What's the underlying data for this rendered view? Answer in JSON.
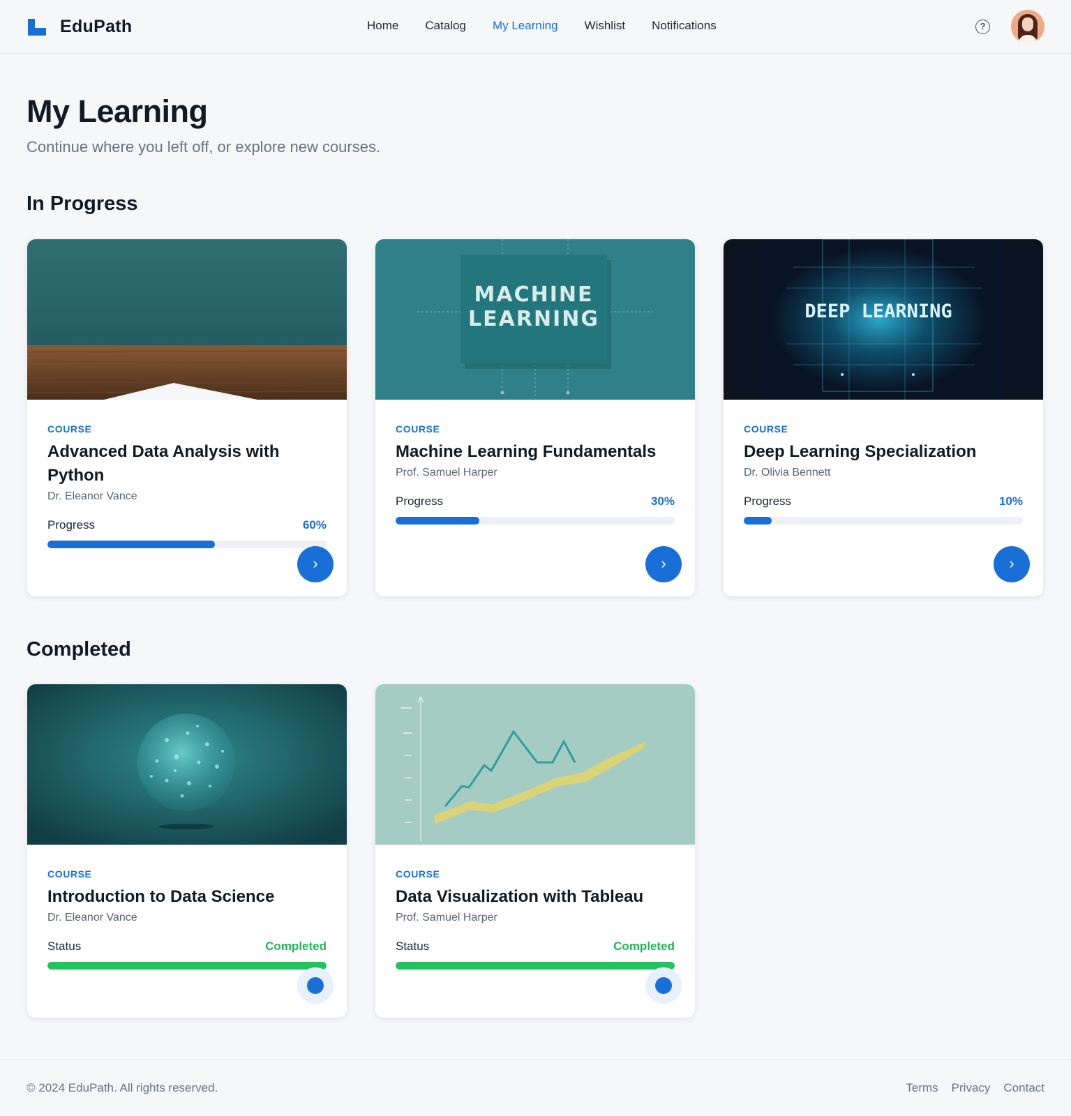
{
  "app": {
    "brand_name": "EduPath",
    "accent_color": "#1a6fd6",
    "success_color": "#22c35e"
  },
  "nav": {
    "items": [
      {
        "label": "Home",
        "active": false
      },
      {
        "label": "Catalog",
        "active": false
      },
      {
        "label": "My Learning",
        "active": true
      },
      {
        "label": "Wishlist",
        "active": false
      },
      {
        "label": "Notifications",
        "active": false
      }
    ],
    "help_icon": "question-circle-icon",
    "avatar_icon": "user-avatar"
  },
  "page": {
    "title": "My Learning",
    "subtitle": "Continue where you left off, or explore new courses."
  },
  "sections": {
    "in_progress": {
      "title": "In Progress",
      "courses": [
        {
          "tag": "COURSE",
          "title": "Advanced Data Analysis with Python",
          "instructor": "Dr. Eleanor Vance",
          "label": "Progress",
          "value_text": "60%",
          "progress": 0.6,
          "thumbnail": "document-on-desk"
        },
        {
          "tag": "COURSE",
          "title": "Machine Learning Fundamentals",
          "instructor": "Prof. Samuel Harper",
          "label": "Progress",
          "value_text": "30%",
          "progress": 0.3,
          "thumbnail": "machine-learning-chip",
          "thumbnail_text": [
            "MACHINE",
            "LEARNING"
          ]
        },
        {
          "tag": "COURSE",
          "title": "Deep Learning Specialization",
          "instructor": "Dr. Olivia Bennett",
          "label": "Progress",
          "value_text": "10%",
          "progress": 0.1,
          "thumbnail": "deep-learning-circuit",
          "thumbnail_text": [
            "DEEP LEARNING"
          ]
        }
      ]
    },
    "completed": {
      "title": "Completed",
      "courses": [
        {
          "tag": "COURSE",
          "title": "Introduction to Data Science",
          "instructor": "Dr. Eleanor Vance",
          "label": "Status",
          "value_text": "Completed",
          "progress": 1.0,
          "thumbnail": "particle-sphere"
        },
        {
          "tag": "COURSE",
          "title": "Data Visualization with Tableau",
          "instructor": "Prof. Samuel Harper",
          "label": "Status",
          "value_text": "Completed",
          "progress": 1.0,
          "thumbnail": "line-chart-graphic"
        }
      ]
    }
  },
  "footer": {
    "copyright": "© 2024 EduPath. All rights reserved.",
    "links": [
      "Terms",
      "Privacy",
      "Contact"
    ]
  }
}
